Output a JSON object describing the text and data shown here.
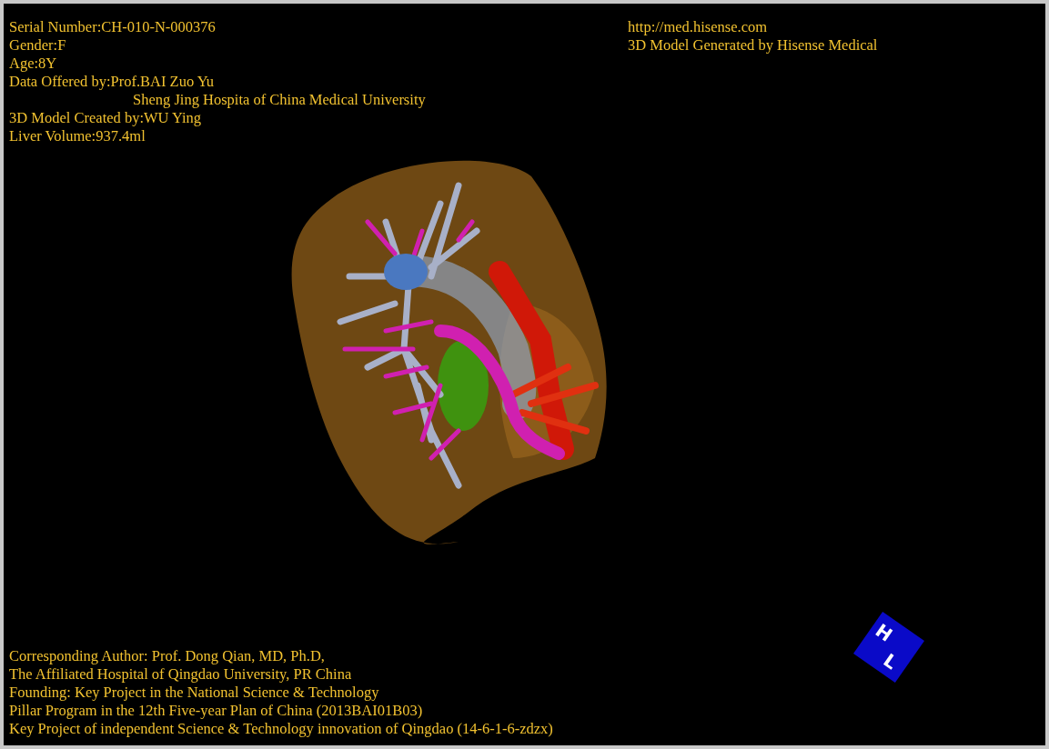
{
  "info_top_left": [
    {
      "kind": "line",
      "text": "Serial Number:CH-010-N-000376"
    },
    {
      "kind": "line",
      "text": "Gender:F"
    },
    {
      "kind": "line",
      "text": "Age:8Y"
    },
    {
      "kind": "line",
      "text": "Data Offered by:Prof.BAI Zuo Yu"
    },
    {
      "kind": "continuation",
      "text": "Sheng Jing Hospita of China Medical University"
    },
    {
      "kind": "line",
      "text": "3D Model Created by:WU Ying"
    },
    {
      "kind": "line",
      "text": "Liver Volume:937.4ml"
    }
  ],
  "info_top_right": [
    "http://med.hisense.com",
    "3D Model Generated by Hisense Medical"
  ],
  "info_bottom": [
    "Corresponding Author: Prof. Dong Qian, MD, Ph.D,",
    "The Affiliated Hospital of Qingdao University, PR China",
    "Founding: Key Project in the National Science & Technology",
    "Pillar Program in the 12th Five-year Plan of China (2013BAI01B03)",
    "Key Project of independent Science & Technology innovation of Qingdao (14-6-1-6-zdzx)"
  ],
  "orientation_cube": {
    "labels": [
      "H",
      "L"
    ]
  }
}
